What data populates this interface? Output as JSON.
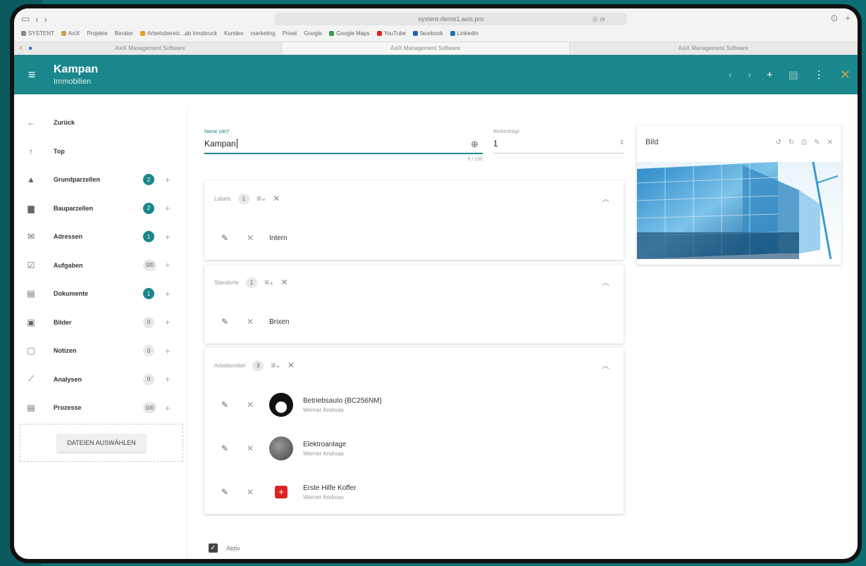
{
  "browser": {
    "url": "systent-demo1.axis.pro",
    "url_extra": "Ⓐ ⟳",
    "bookmarks": [
      "SYSTENT",
      "AxiX",
      "Projekte",
      "Berater",
      "Arbeitsbereic...ab Innsbruck",
      "Kunden",
      "marketing",
      "Privat",
      "Google",
      "Google Maps",
      "YouTube",
      "facebook",
      "LinkedIn"
    ],
    "tabs": [
      "AxiX Management Software",
      "AxiX Management Software",
      "AxiX Management Software"
    ]
  },
  "appbar": {
    "title": "Kampan",
    "subtitle": "Immobilien"
  },
  "sidebar": {
    "items": [
      {
        "label": "Zurück",
        "icon": "←",
        "badge": "",
        "plus": false
      },
      {
        "label": "Top",
        "icon": "↑",
        "badge": "",
        "plus": false
      },
      {
        "label": "Grundparzellen",
        "icon": "▲",
        "badge": "2",
        "badge_style": "teal",
        "plus": true
      },
      {
        "label": "Bauparzellen",
        "icon": "▆",
        "badge": "2",
        "badge_style": "teal",
        "plus": true
      },
      {
        "label": "Adressen",
        "icon": "✉",
        "badge": "1",
        "badge_style": "teal",
        "plus": true
      },
      {
        "label": "Aufgaben",
        "icon": "☑",
        "badge": "0/0",
        "badge_style": "gray",
        "plus": true
      },
      {
        "label": "Dokumente",
        "icon": "▤",
        "badge": "1",
        "badge_style": "teal",
        "plus": true
      },
      {
        "label": "Bilder",
        "icon": "▣",
        "badge": "0",
        "badge_style": "gray",
        "plus": true
      },
      {
        "label": "Notizen",
        "icon": "▢",
        "badge": "0",
        "badge_style": "gray",
        "plus": true
      },
      {
        "label": "Analysen",
        "icon": "⟋",
        "badge": "0",
        "badge_style": "gray",
        "plus": true
      },
      {
        "label": "Prozesse",
        "icon": "▤",
        "badge": "0/0",
        "badge_style": "gray",
        "plus": true
      }
    ],
    "upload_label": "DATEIEN AUSWÄHLEN"
  },
  "form": {
    "name_label": "Name (de)*",
    "name_value": "Kampan",
    "name_counter": "6 / 150",
    "order_label": "Reihenfolge",
    "order_value": "1"
  },
  "cards": {
    "labels": {
      "title": "Labels",
      "count": "1",
      "rows": [
        {
          "title": "Intern"
        }
      ]
    },
    "standorte": {
      "title": "Standorte",
      "count": "1",
      "rows": [
        {
          "title": "Brixen"
        }
      ]
    },
    "arbeitsmittel": {
      "title": "Arbeitsmittel",
      "count": "3",
      "rows": [
        {
          "title": "Betriebsauto (BC256NM)",
          "sub": "Werner Andreas"
        },
        {
          "title": "Elektroanlage",
          "sub": "Werner Andreas"
        },
        {
          "title": "Erste Hilfe Koffer",
          "sub": "Werner Andreas"
        }
      ]
    }
  },
  "aktiv_label": "Aktiv",
  "image_panel": {
    "title": "Bild"
  },
  "colors": {
    "primary": "#1a878c",
    "accent": "#c7a34a"
  }
}
